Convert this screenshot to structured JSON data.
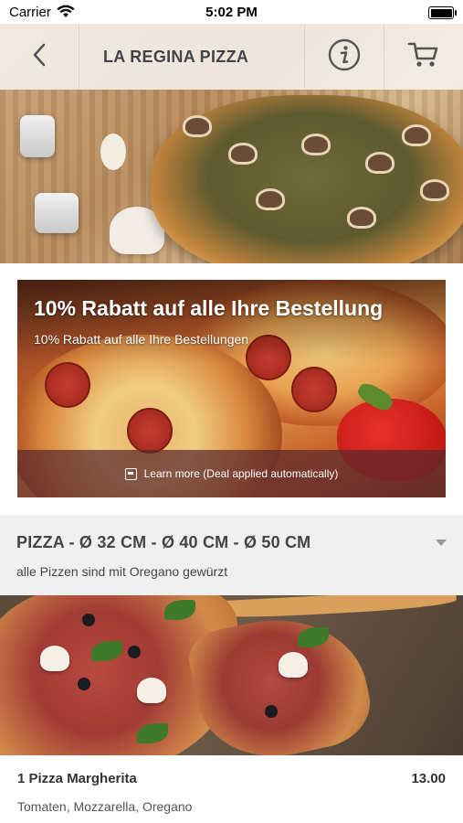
{
  "status_bar": {
    "carrier": "Carrier",
    "time": "5:02 PM"
  },
  "navbar": {
    "title": "LA REGINA PIZZA",
    "back_icon": "chevron-left-icon",
    "info_icon": "info-icon",
    "cart_icon": "cart-icon"
  },
  "promo": {
    "headline": "10% Rabatt auf alle Ihre Bestellung",
    "subtitle": "10% Rabatt auf alle Ihre Bestellungen",
    "learn_more": "Learn more (Deal applied automatically)"
  },
  "category": {
    "title": "PIZZA - Ø 32 CM - Ø 40 CM - Ø 50 CM",
    "description": "alle Pizzen sind mit Oregano gewürzt"
  },
  "products": [
    {
      "name": "1 Pizza Margherita",
      "price": "13.00",
      "description": "Tomaten, Mozzarella, Oregano"
    }
  ],
  "colors": {
    "navbar_bg": "#f5f2ee",
    "category_bg": "#f0f0f0",
    "learn_more_bg": "#5a282d"
  }
}
